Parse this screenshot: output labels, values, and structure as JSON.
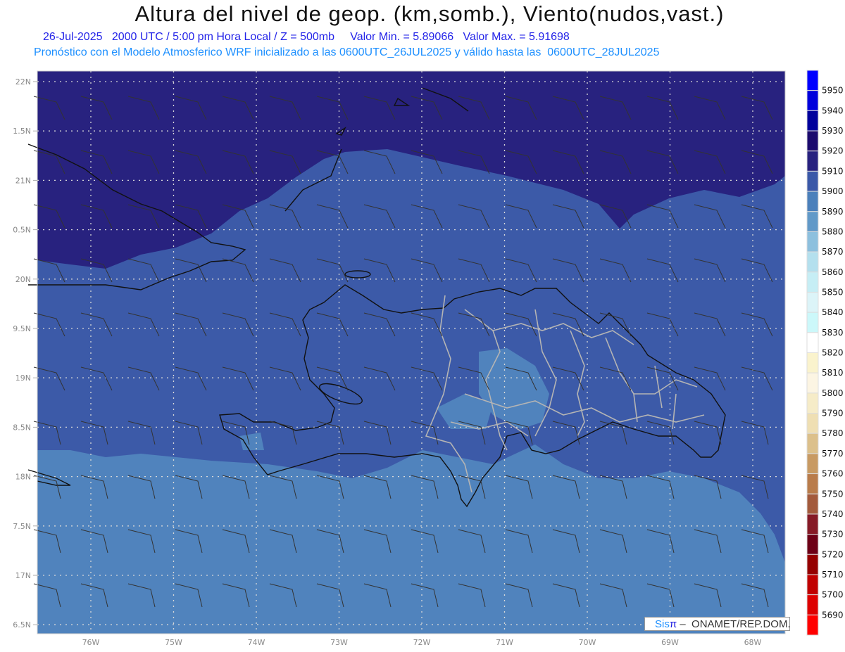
{
  "header": {
    "title": "Altura del nivel de geop. (km,somb.), Viento(nudos,vast.)",
    "subtitle": "26-Jul-2025   2000 UTC / 5:00 pm Hora Local / Z = 500mb     Valor Min. = 5.89066   Valor Max. = 5.91698",
    "model_line": "Pronóstico con el Modelo Atmosferico WRF inicializado a las 0600UTC_26JUL2025 y válido hasta las  0600UTC_28JUL2025"
  },
  "axes": {
    "lat_labels": [
      "22N",
      "1.5N",
      "21N",
      "0.5N",
      "20N",
      "9.5N",
      "19N",
      "8.5N",
      "18N",
      "7.5N",
      "17N",
      "6.5N"
    ],
    "lon_labels": [
      "76W",
      "75W",
      "74W",
      "73W",
      "72W",
      "71W",
      "70W",
      "69W",
      "68W"
    ]
  },
  "colorbar": {
    "labels": [
      "5950",
      "5940",
      "5930",
      "5920",
      "5910",
      "5900",
      "5890",
      "5880",
      "5870",
      "5860",
      "5850",
      "5840",
      "5830",
      "5820",
      "5810",
      "5800",
      "5790",
      "5780",
      "5770",
      "5760",
      "5750",
      "5740",
      "5730",
      "5720",
      "5710",
      "5700",
      "5690"
    ],
    "colors": [
      "#0000ff",
      "#0000dc",
      "#00009c",
      "#1b0a6e",
      "#27217f",
      "#3a58a8",
      "#4b80bb",
      "#6199c8",
      "#8dc0de",
      "#b4e0ee",
      "#c6eef5",
      "#dcf4f8",
      "#ccf8fa",
      "#ffffff",
      "#faf3cd",
      "#fcf5e3",
      "#f6ecc8",
      "#efdfb3",
      "#dcc08b",
      "#c89a63",
      "#b97c4b",
      "#a35a3c",
      "#861a26",
      "#6d0016",
      "#950000",
      "#c00000",
      "#dd0000",
      "#ff0000"
    ]
  },
  "fields": {
    "upper": "#28227f",
    "middle": "#3c5aa8",
    "lower": "#5083bd"
  },
  "logo": {
    "sis": "Sis",
    "pi": "π",
    "rest": " –  ONAMET/REP.DOM."
  }
}
